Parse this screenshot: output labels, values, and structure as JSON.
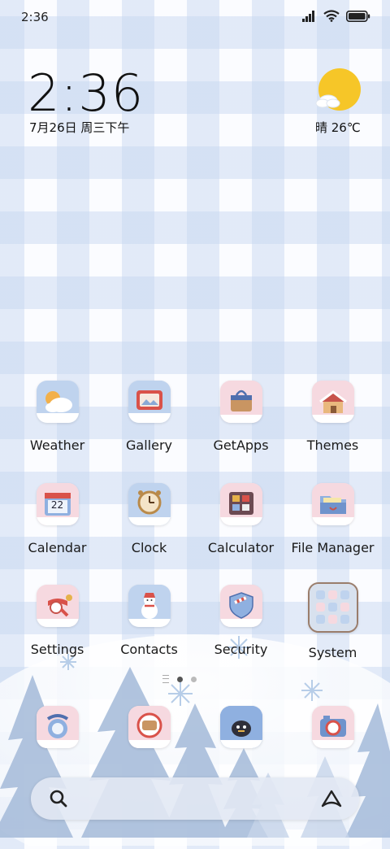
{
  "status_bar": {
    "time": "2:36",
    "icons": [
      "signal-icon",
      "wifi-icon",
      "battery-icon"
    ]
  },
  "clock_widget": {
    "time": "2:36",
    "date": "7月26日 周三下午"
  },
  "weather_widget": {
    "text": "晴 26℃",
    "icon": "sun-cloud-icon"
  },
  "apps": [
    {
      "label": "Weather",
      "icon": "weather-icon"
    },
    {
      "label": "Gallery",
      "icon": "gallery-icon"
    },
    {
      "label": "GetApps",
      "icon": "getapps-icon"
    },
    {
      "label": "Themes",
      "icon": "themes-icon"
    },
    {
      "label": "Calendar",
      "icon": "calendar-icon",
      "badge": "22"
    },
    {
      "label": "Clock",
      "icon": "clock-icon"
    },
    {
      "label": "Calculator",
      "icon": "calculator-icon"
    },
    {
      "label": "File Manager",
      "icon": "file-manager-icon"
    },
    {
      "label": "Settings",
      "icon": "settings-icon"
    },
    {
      "label": "Contacts",
      "icon": "contacts-icon"
    },
    {
      "label": "Security",
      "icon": "security-icon"
    },
    {
      "label": "System",
      "icon": "system-folder-icon"
    }
  ],
  "dock": [
    {
      "icon": "phone-icon"
    },
    {
      "icon": "messages-icon"
    },
    {
      "icon": "browser-icon"
    },
    {
      "icon": "camera-icon"
    }
  ],
  "page_indicator": {
    "pages": 2,
    "current": 1
  },
  "search_bar": {
    "left_icon": "search-icon",
    "right_icon": "assistant-icon"
  }
}
